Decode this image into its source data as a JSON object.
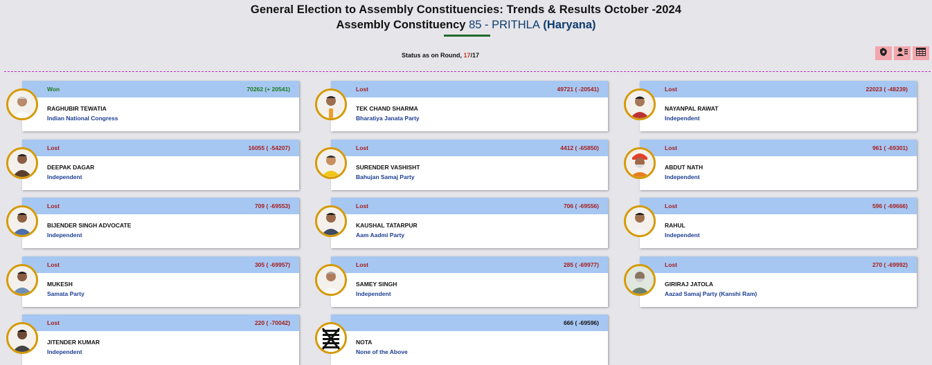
{
  "header": {
    "title": "General Election to Assembly Constituencies: Trends & Results October -2024",
    "ac_prefix": "Assembly Constituency",
    "ac_number": "85",
    "ac_sep": "-",
    "ac_name": "PRITHLA",
    "ac_state": "(Haryana)"
  },
  "status": {
    "prefix": "Status as on Round,",
    "current": "17",
    "slash": "/",
    "total": "17"
  },
  "toolbar": {
    "icons": [
      "map-icon",
      "candidate-icon",
      "table-icon"
    ]
  },
  "candidates": [
    {
      "status": "Won",
      "votes": "70262 (+ 20541)",
      "name": "RAGHUBIR TEWATIA",
      "party": "Indian National Congress"
    },
    {
      "status": "Lost",
      "votes": "49721 ( -20541)",
      "name": "TEK CHAND SHARMA",
      "party": "Bharatiya Janata Party"
    },
    {
      "status": "Lost",
      "votes": "22023 ( -48239)",
      "name": "NAYANPAL RAWAT",
      "party": "Independent"
    },
    {
      "status": "Lost",
      "votes": "16055 ( -54207)",
      "name": "DEEPAK DAGAR",
      "party": "Independent"
    },
    {
      "status": "Lost",
      "votes": "4412 ( -65850)",
      "name": "SURENDER VASHISHT",
      "party": "Bahujan Samaj Party"
    },
    {
      "status": "Lost",
      "votes": "961 ( -69301)",
      "name": "ABDUT NATH",
      "party": "Independent"
    },
    {
      "status": "Lost",
      "votes": "709 ( -69553)",
      "name": "BIJENDER SINGH ADVOCATE",
      "party": "Independent"
    },
    {
      "status": "Lost",
      "votes": "706 ( -69556)",
      "name": "KAUSHAL TATARPUR",
      "party": "Aam Aadmi Party"
    },
    {
      "status": "Lost",
      "votes": "596 ( -69666)",
      "name": "RAHUL",
      "party": "Independent"
    },
    {
      "status": "Lost",
      "votes": "305 ( -69957)",
      "name": "MUKESH",
      "party": "Samata Party"
    },
    {
      "status": "Lost",
      "votes": "285 ( -69977)",
      "name": "SAMEY SINGH",
      "party": "Independent"
    },
    {
      "status": "Lost",
      "votes": "270 ( -69992)",
      "name": "GIRIRAJ JATOLA",
      "party": "Aazad Samaj Party (Kanshi Ram)"
    },
    {
      "status": "Lost",
      "votes": "220 ( -70042)",
      "name": "JITENDER KUMAR",
      "party": "Independent"
    },
    {
      "status": "",
      "votes": "666 ( -69596)",
      "name": "NOTA",
      "party": "None of the Above"
    }
  ],
  "colors": {
    "background": "#e6e5ea",
    "card_header": "#a6c7f2",
    "won": "#1d7a1d",
    "lost": "#a51d1d",
    "party": "#1b3d91",
    "avatar_ring": "#d59a06",
    "toolbar_button": "#f3a6ad",
    "divider": "#c12bc9"
  }
}
